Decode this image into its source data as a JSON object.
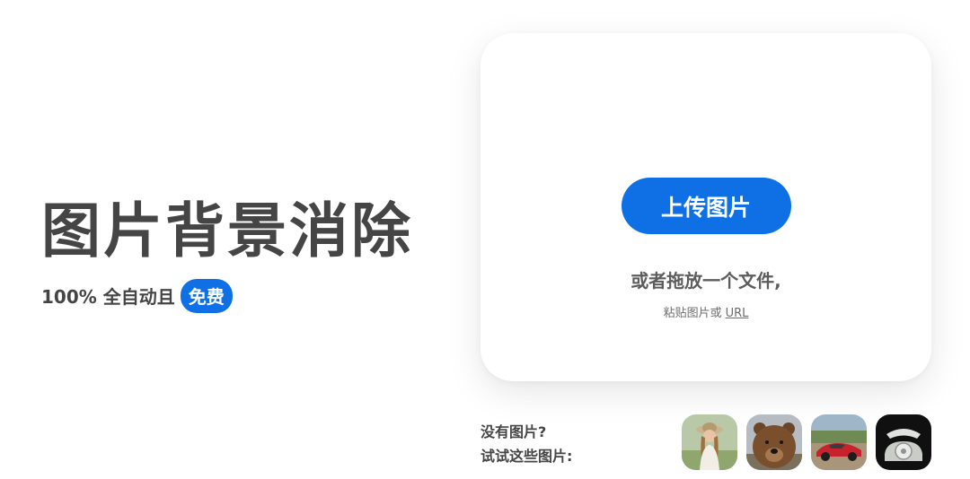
{
  "hero": {
    "title": "图片背景消除",
    "subtitle_prefix": "100% 全自动且",
    "badge": "免费"
  },
  "upload": {
    "button_label": "上传图片",
    "drop_text": "或者拖放一个文件,",
    "paste_text": "粘贴图片或",
    "url_link": "URL"
  },
  "samples": {
    "line1": "没有图片?",
    "line2": "试试这些图片:",
    "thumbnails": [
      "woman-photo",
      "bear-photo",
      "car-photo",
      "telephone-photo"
    ]
  },
  "colors": {
    "accent": "#0f70e6",
    "text": "#454545"
  }
}
